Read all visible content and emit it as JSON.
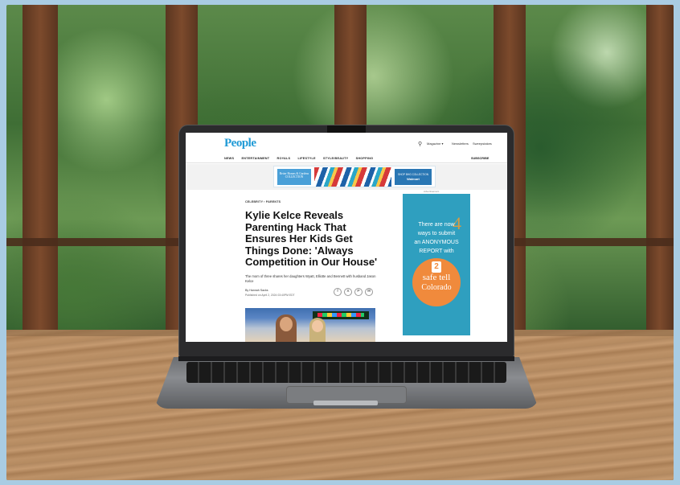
{
  "site": {
    "logo": "People",
    "utility": [
      "Magazine ▾",
      "Newsletters",
      "Sweepstakes"
    ],
    "nav": [
      "NEWS",
      "ENTERTAINMENT",
      "ROYALS",
      "LIFESTYLE",
      "STYLE/BEAUTY",
      "SHOPPING"
    ],
    "subscribe": "SUBSCRIBE"
  },
  "top_ad": {
    "brand": "Better Homes & Gardens",
    "brand_sub": "COLLECTION",
    "cta_line1": "SHOP BHG COLLECTION",
    "cta_line2": "Walmart"
  },
  "article": {
    "breadcrumb": "CELEBRITY  ›  PARENTS",
    "headline": "Kylie Kelce Reveals Parenting Hack That Ensures Her Kids Get Things Done: 'Always Competition in Our House'",
    "dek": "The mom of three shares her daughters Wyatt, Elliotte and Bennett with husband Jason Kelce",
    "byline": "By Hannah Sacks",
    "published": "Published on April 2, 2024 03:40PM EDT",
    "share_icons": [
      "f",
      "X",
      "P",
      "✉"
    ]
  },
  "side_ad": {
    "label": "Advertisement",
    "line1": "There are now",
    "line2": "ways to submit",
    "line3": "an ANONYMOUS",
    "line4": "REPORT with",
    "big_number": "4",
    "logo_num": "2",
    "logo_text1": "safe",
    "logo_text2": "tell",
    "logo_text3": "Colorado"
  }
}
